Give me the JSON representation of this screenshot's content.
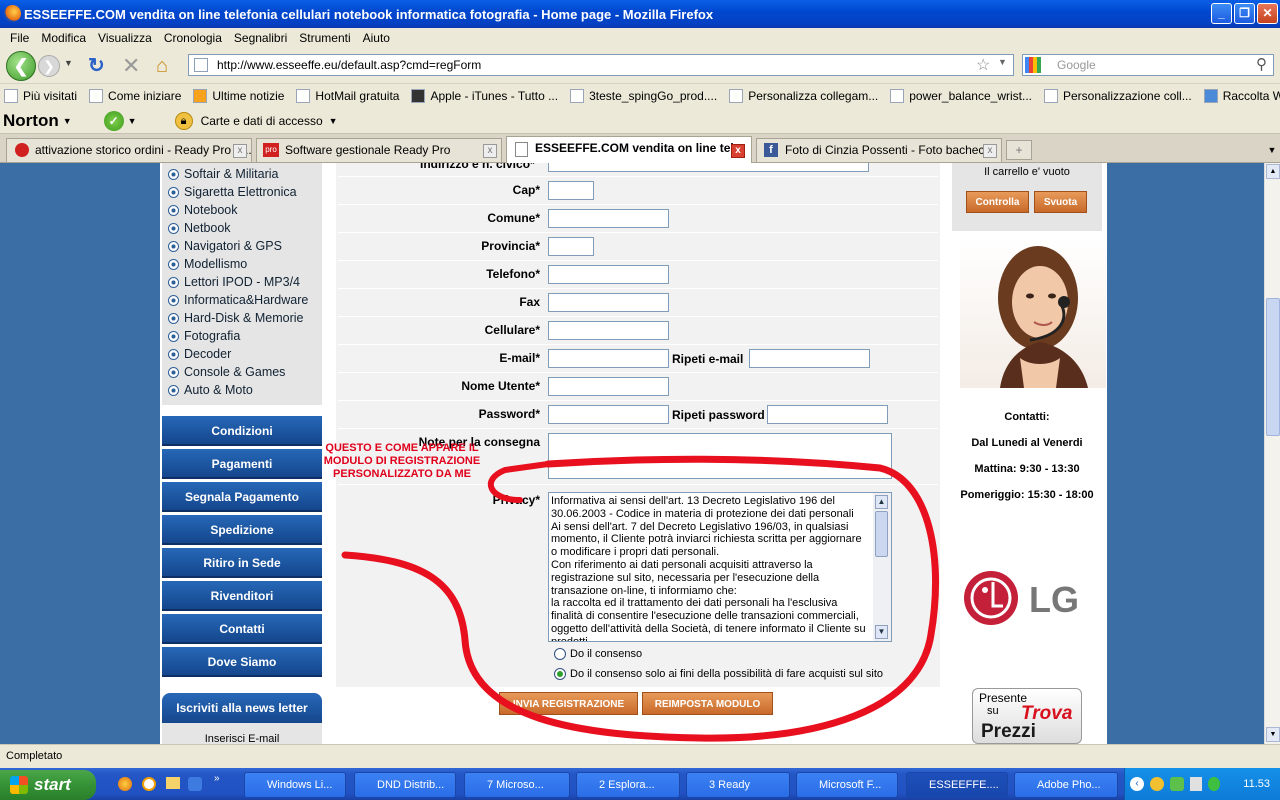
{
  "window": {
    "title": "ESSEEFFE.COM vendita on line telefonia cellulari notebook informatica fotografia - Home page - Mozilla Firefox",
    "minimize": "_",
    "maximize": "❐",
    "close": "✕"
  },
  "menu": [
    "File",
    "Modifica",
    "Visualizza",
    "Cronologia",
    "Segnalibri",
    "Strumenti",
    "Aiuto"
  ],
  "nav": {
    "url": "http://www.esseeffe.eu/default.asp?cmd=regForm",
    "search_placeholder": "Google"
  },
  "bookmarks": [
    "Più visitati",
    "Come iniziare",
    "Ultime notizie",
    "HotMail gratuita",
    "Apple - iTunes - Tutto ...",
    "3teste_spingGo_prod....",
    "Personalizza collegam...",
    "power_balance_wrist...",
    "Personalizzazione coll...",
    "Raccolta Web Slice"
  ],
  "norton": {
    "brand": "Norton",
    "identity": "Carte e dati di accesso"
  },
  "tabs": [
    {
      "label": "attivazione storico ordini - Ready Pro - ...",
      "active": false
    },
    {
      "label": "Software gestionale Ready Pro",
      "active": false
    },
    {
      "label": "ESSEEFFE.COM vendita on line tel...",
      "active": true
    },
    {
      "label": "Foto di Cinzia Possenti - Foto bacheca",
      "active": false
    }
  ],
  "sidebar": {
    "categories": [
      "Softair & Militaria",
      "Sigaretta Elettronica",
      "Notebook",
      "Netbook",
      "Navigatori & GPS",
      "Modellismo",
      "Lettori IPOD - MP3/4",
      "Informatica&Hardware",
      "Hard-Disk & Memorie",
      "Fotografia",
      "Decoder",
      "Console & Games",
      "Auto & Moto"
    ],
    "buttons": [
      "Condizioni",
      "Pagamenti",
      "Segnala Pagamento",
      "Spedizione",
      "Ritiro in Sede",
      "Rivenditori",
      "Contatti",
      "Dove Siamo"
    ],
    "newsletter_title": "Iscriviti alla news letter",
    "newsletter_email": "Inserisci E-mail"
  },
  "form": {
    "address_label": "Indirizzo e n. civico*",
    "cap": "Cap*",
    "comune": "Comune*",
    "provincia": "Provincia*",
    "telefono": "Telefono*",
    "fax": "Fax",
    "cellulare": "Cellulare*",
    "email": "E-mail*",
    "repeat_email": "Ripeti e-mail",
    "username": "Nome Utente*",
    "password": "Password*",
    "repeat_password": "Ripeti password",
    "notes": "Note per la consegna",
    "privacy": "Privacy*",
    "privacy_text": "Informativa ai sensi dell'art. 13 Decreto Legislativo 196 del 30.06.2003 - Codice in materia di protezione dei dati personali\nAi sensi dell'art. 7 del Decreto Legislativo 196/03, in qualsiasi momento, il Cliente potrà inviarci richiesta scritta per aggiornare o modificare i propri dati personali.\nCon riferimento ai dati personali acquisiti attraverso la registrazione sul sito, necessaria per l'esecuzione della transazione on-line, ti informiamo che:\nla raccolta ed il trattamento dei dati personali ha l'esclusiva finalità di consentire l'esecuzione delle transazioni commerciali, oggetto dell'attività della Società, di tenere informato il Cliente su prodotti",
    "consent_full": "Do il consenso",
    "consent_partial": "Do il consenso solo ai fini della possibilità di fare acquisti sul sito",
    "submit": "INVIA REGISTRAZIONE",
    "reset": "REIMPOSTA MODULO"
  },
  "annotation": "QUESTO E COME APPARE IL MODULO DI REGISTRAZIONE PERSONALIZZATO DA ME",
  "cart": {
    "status": "Il carrello e' vuoto",
    "check": "Controlla",
    "empty": "Svuota"
  },
  "contacts": {
    "title": "Contatti:",
    "days": "Dal Lunedi al Venerdi",
    "morning": "Mattina: 9:30 - 13:30",
    "afternoon": "Pomeriggio: 15:30 - 18:00"
  },
  "brand_logo": "LG",
  "trovaprezzi": {
    "line1": "Presente",
    "line2": "su",
    "brand1": "Trova",
    "brand2": "Prezzi"
  },
  "status": "Completato",
  "taskbar": {
    "start": "start",
    "items": [
      "Windows Li...",
      "DND Distrib...",
      "7 Microso...",
      "2 Esplora...",
      "3 Ready",
      "Microsoft F...",
      "ESSEEFFE....",
      "Adobe Pho..."
    ],
    "clock": "11.53"
  },
  "colors": {
    "accent_blue": "#1c4f9a",
    "orange": "#d27a3a",
    "annotation_red": "#e0001b"
  }
}
